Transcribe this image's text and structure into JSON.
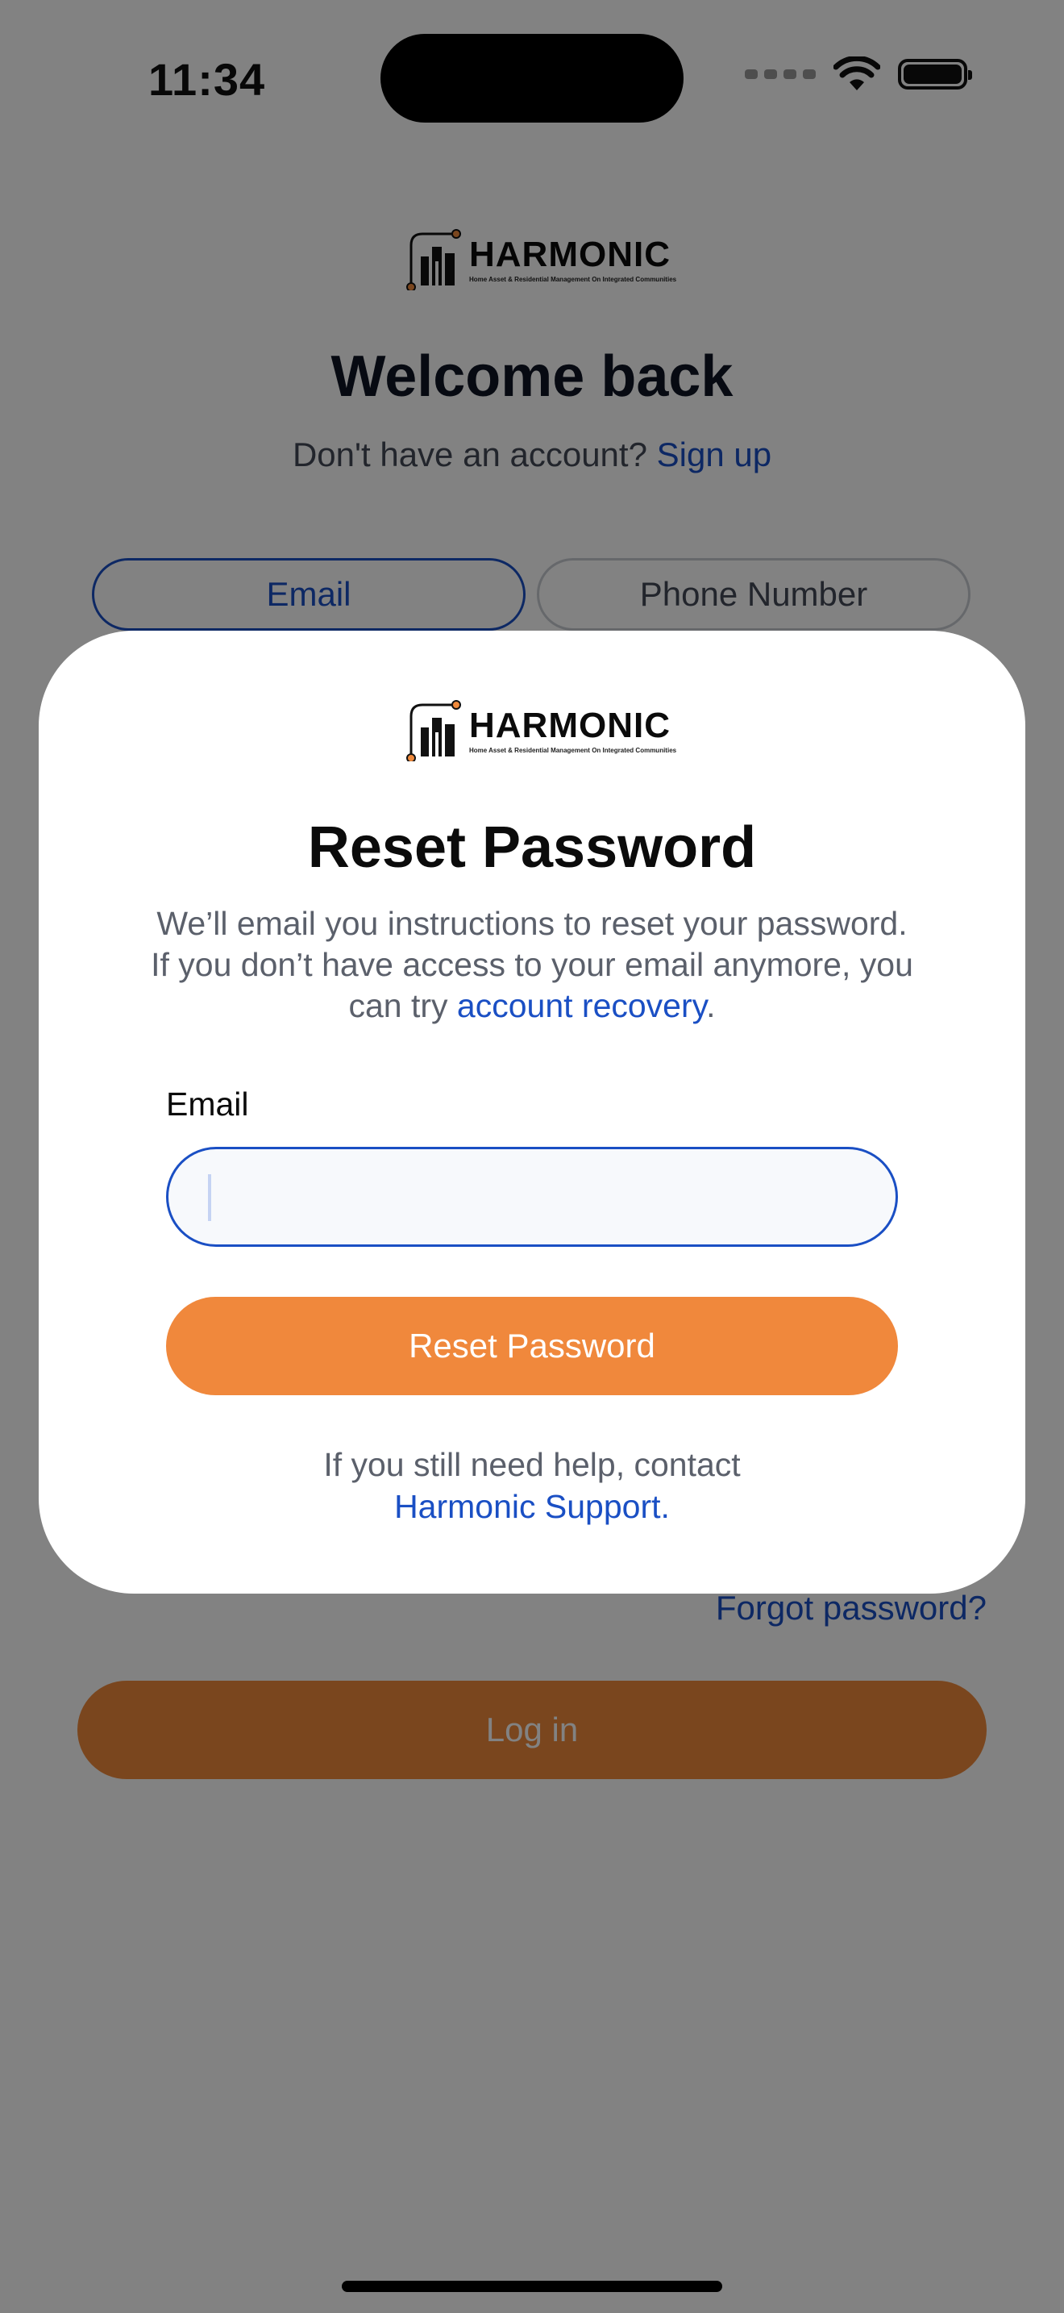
{
  "status_bar": {
    "time": "11:34"
  },
  "brand": {
    "name": "HARMONIC",
    "tagline": "Home Asset & Residential Management On Integrated Communities"
  },
  "background": {
    "title": "Welcome back",
    "signup_prompt": "Don't have an account?",
    "signup_link": "Sign up",
    "tabs": [
      {
        "label": "Email",
        "selected": true
      },
      {
        "label": "Phone Number",
        "selected": false
      }
    ],
    "forgot_password": "Forgot password?",
    "login_button": "Log in"
  },
  "modal": {
    "title": "Reset Password",
    "description_prefix": "We’ll email you instructions to reset your password. If you don’t have access to your email anymore, you can try ",
    "description_link": "account recovery",
    "description_suffix": ".",
    "email_label": "Email",
    "email_value": "",
    "submit_button": "Reset Password",
    "help_text": "If you still need help, contact",
    "help_link": "Harmonic Support."
  },
  "colors": {
    "brand_blue": "#1a4fc4",
    "brand_orange": "#f0883c",
    "overlay": "rgba(0,0,0,0.49)"
  },
  "icons": {
    "wifi": "wifi-icon",
    "battery": "battery-icon",
    "signal": "cellular-signal-icon",
    "logo": "harmonic-building-logo-icon"
  }
}
